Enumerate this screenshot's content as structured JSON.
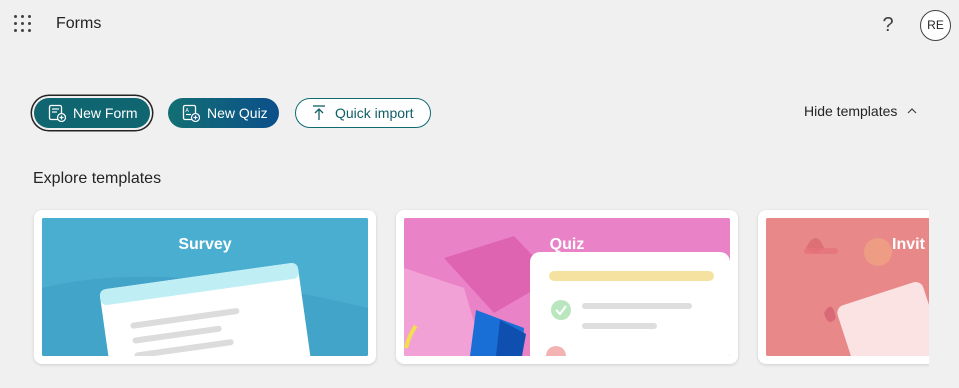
{
  "header": {
    "app_title": "Forms",
    "help_label": "?",
    "avatar_initials": "RE",
    "icons": [
      "app-launcher-icon",
      "help-icon"
    ]
  },
  "actions": {
    "new_form": "New Form",
    "new_quiz": "New Quiz",
    "quick_import": "Quick import",
    "hide_templates": "Hide templates"
  },
  "templates": {
    "section_title": "Explore templates",
    "items": [
      {
        "label": "Survey",
        "bg": "#4aa9c9"
      },
      {
        "label": "Quiz",
        "bg": "#e97fc4"
      },
      {
        "label": "Invit",
        "bg": "#e88a8a"
      }
    ]
  },
  "colors": {
    "page_bg": "#f0f0f0",
    "primary": "#0f6570",
    "quiz_gradient_end": "#0b4f8a"
  }
}
